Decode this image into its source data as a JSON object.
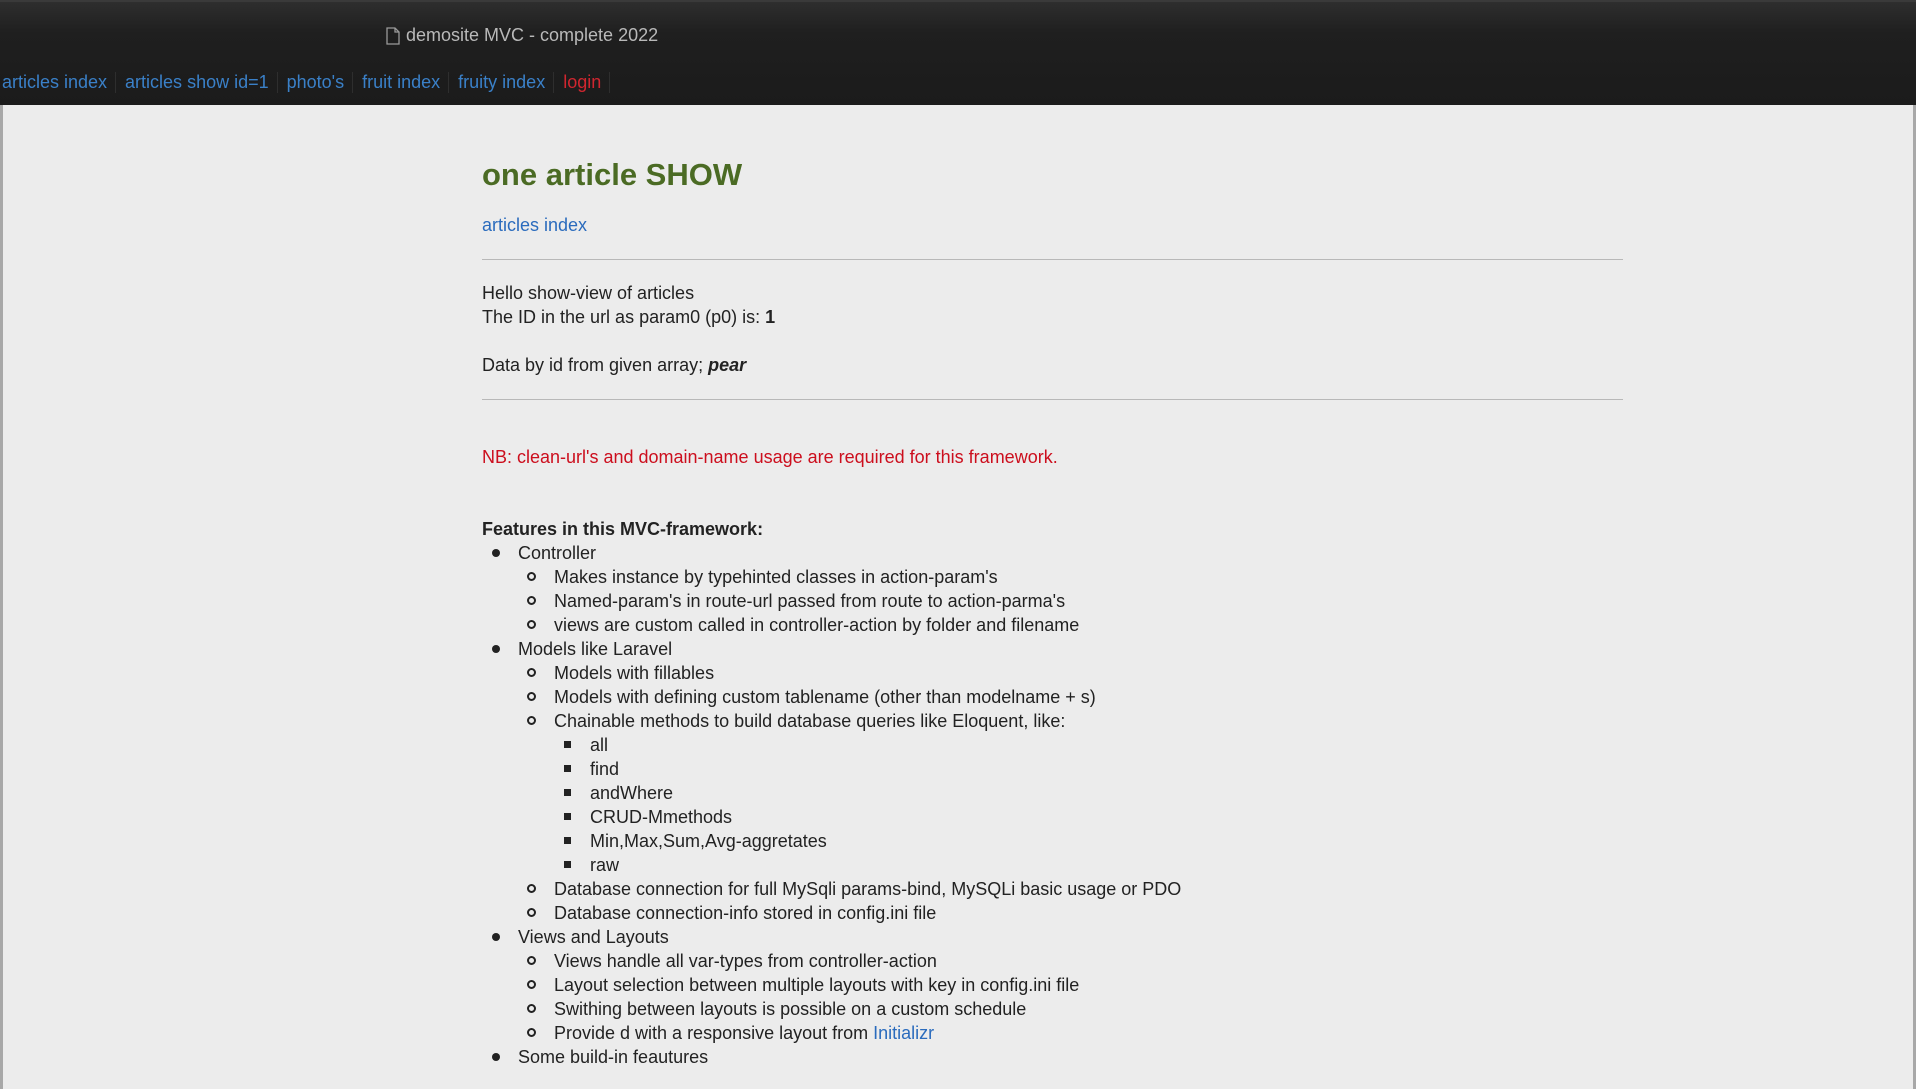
{
  "header": {
    "title": "demosite MVC - complete 2022",
    "nav": [
      {
        "label": "articles index"
      },
      {
        "label": "articles show id=1"
      },
      {
        "label": "photo's"
      },
      {
        "label": "fruit index"
      },
      {
        "label": "fruity index"
      },
      {
        "label": "login"
      }
    ]
  },
  "main": {
    "heading": "one article SHOW",
    "back_link": "articles index",
    "hello": "Hello show-view of articles",
    "id_prefix": "The ID in the url as param0 (p0) is: ",
    "id_value": "1",
    "data_prefix": "Data by id from given array; ",
    "data_value": "pear",
    "notice": "NB: clean-url's and domain-name usage are required for this framework.",
    "features_title": "Features in this MVC-framework:",
    "features": [
      {
        "label": "Controller",
        "items": [
          {
            "label": "Makes instance by typehinted classes in action-param's"
          },
          {
            "label": "Named-param's in route-url passed from route to action-parma's"
          },
          {
            "label": "views are custom called in controller-action by folder and filename"
          }
        ]
      },
      {
        "label": "Models like Laravel",
        "items": [
          {
            "label": "Models with fillables"
          },
          {
            "label": "Models with defining custom tablename (other than modelname + s)"
          },
          {
            "label": "Chainable methods to build database queries like Eloquent, like:",
            "items": [
              "all",
              "find",
              "andWhere",
              "CRUD-Mmethods",
              "Min,Max,Sum,Avg-aggretates",
              "raw"
            ]
          },
          {
            "label": "Database connection for full MySqli params-bind, MySQLi basic usage or PDO"
          },
          {
            "label": "Database connection-info stored in config.ini file"
          }
        ]
      },
      {
        "label": "Views and Layouts",
        "items": [
          {
            "label": "Views handle all var-types from controller-action"
          },
          {
            "label": "Layout selection between multiple layouts with key in config.ini file"
          },
          {
            "label": "Swithing between layouts is possible on a custom schedule"
          },
          {
            "label": "Provide d with a responsive layout from ",
            "link": "Initializr"
          }
        ]
      },
      {
        "label": "Some build-in feautures",
        "items": []
      }
    ]
  }
}
